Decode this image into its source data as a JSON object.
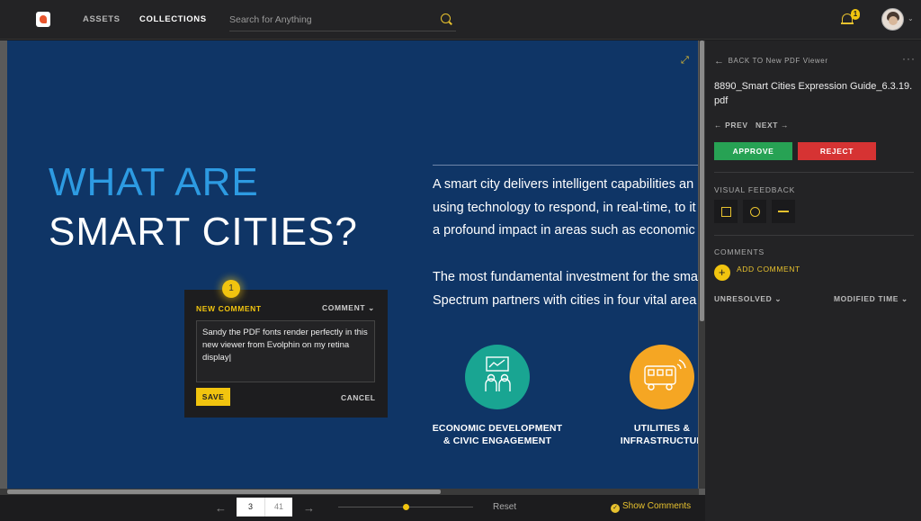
{
  "topbar": {
    "nav": [
      "ASSETS",
      "COLLECTIONS"
    ],
    "search_placeholder": "Search for Anything",
    "notification_count": "1"
  },
  "document": {
    "title_line1": "WHAT ARE",
    "title_line2": "SMART CITIES?",
    "para1": [
      "A smart city delivers intelligent capabilities an",
      "using technology to respond, in real-time, to it",
      "a profound impact in areas such as economic"
    ],
    "para2": [
      "The most fundamental investment for the sma",
      "Spectrum partners with cities in four vital area"
    ],
    "caption1": [
      "ECONOMIC DEVELOPMENT",
      "& CIVIC ENGAGEMENT"
    ],
    "caption2": [
      "UTILITIES &",
      "INFRASTRUCTUR"
    ]
  },
  "comment_popup": {
    "marker_number": "1",
    "label": "NEW COMMENT",
    "type_label": "COMMENT",
    "text": "Sandy the PDF fonts render perfectly in this new viewer from Evolphin on my retina display",
    "save_label": "SAVE",
    "cancel_label": "CANCEL"
  },
  "bottombar": {
    "current_page": "3",
    "total_pages": "41",
    "zoom_level": 0.5,
    "reset_label": "Reset",
    "show_comments_label": "Show Comments"
  },
  "panel": {
    "back_label": "BACK TO New PDF Viewer",
    "more_label": "···",
    "filename": "8890_Smart Cities Expression Guide_6.3.19.pdf",
    "prev_label": "PREV",
    "next_label": "NEXT",
    "approve_label": "APPROVE",
    "reject_label": "REJECT",
    "visual_feedback_label": "VISUAL FEEDBACK",
    "comments_label": "COMMENTS",
    "add_comment_label": "ADD COMMENT",
    "filter_status": "UNRESOLVED",
    "sort_label": "MODIFIED TIME"
  },
  "colors": {
    "accent": "#f1c40f",
    "page_bg": "#0f3566",
    "title_blue": "#2d9be2",
    "approve": "#27a254",
    "reject": "#d63333"
  }
}
